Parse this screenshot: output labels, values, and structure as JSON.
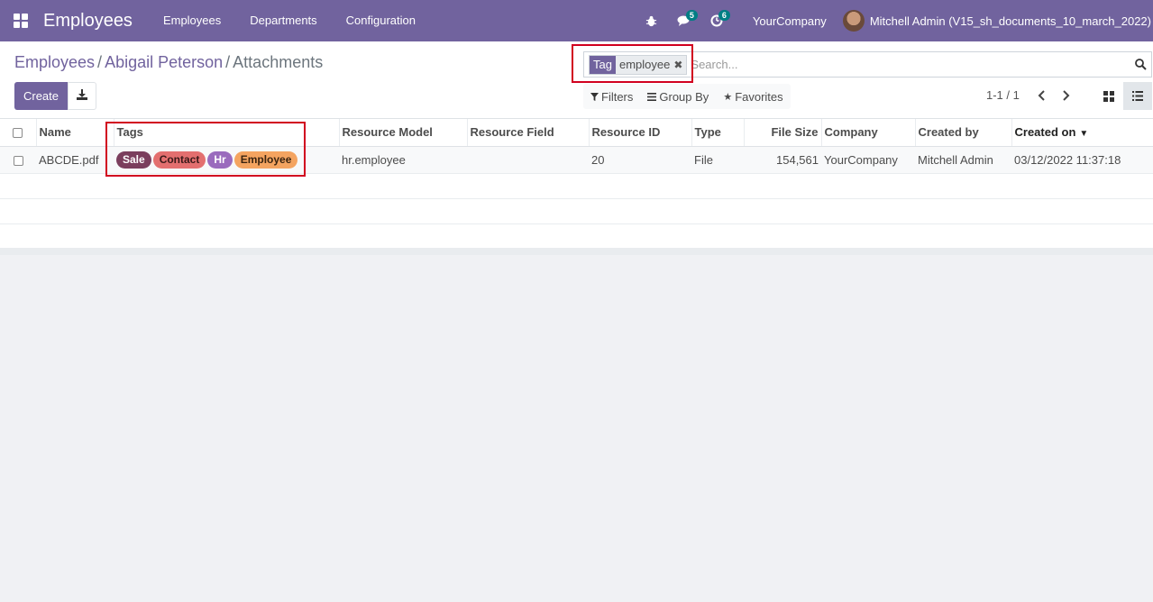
{
  "navbar": {
    "app_title": "Employees",
    "menu": [
      "Employees",
      "Departments",
      "Configuration"
    ],
    "messages_count": "5",
    "activities_count": "6",
    "company": "YourCompany",
    "user": "Mitchell Admin (V15_sh_documents_10_march_2022)"
  },
  "breadcrumb": {
    "crumb1": "Employees",
    "sep": "/",
    "crumb2": "Abigail Peterson",
    "current": "Attachments"
  },
  "toolbar": {
    "create_label": "Create"
  },
  "search": {
    "facet_category": "Tag",
    "facet_value": "employee",
    "placeholder": "Search..."
  },
  "filters": {
    "filters_label": "Filters",
    "groupby_label": "Group By",
    "favorites_label": "Favorites"
  },
  "pager": {
    "text": "1-1 / 1"
  },
  "table": {
    "columns": [
      "Name",
      "Tags",
      "Resource Model",
      "Resource Field",
      "Resource ID",
      "Type",
      "File Size",
      "Company",
      "Created by",
      "Created on"
    ],
    "rows": [
      {
        "name": "ABCDE.pdf",
        "tags": [
          {
            "label": "Sale",
            "bg": "#7b3e5d",
            "fg": "#ffffff"
          },
          {
            "label": "Contact",
            "bg": "#e36f6f",
            "fg": "#3a1a1a"
          },
          {
            "label": "Hr",
            "bg": "#9a6bbd",
            "fg": "#ffffff"
          },
          {
            "label": "Employee",
            "bg": "#f4a460",
            "fg": "#3a2410"
          }
        ],
        "resource_model": "hr.employee",
        "resource_field": "",
        "resource_id": "20",
        "type": "File",
        "file_size": "154,561",
        "company": "YourCompany",
        "created_by": "Mitchell Admin",
        "created_on": "03/12/2022 11:37:18"
      }
    ]
  },
  "colors": {
    "brand": "#71639e",
    "highlight": "#d1001f"
  }
}
